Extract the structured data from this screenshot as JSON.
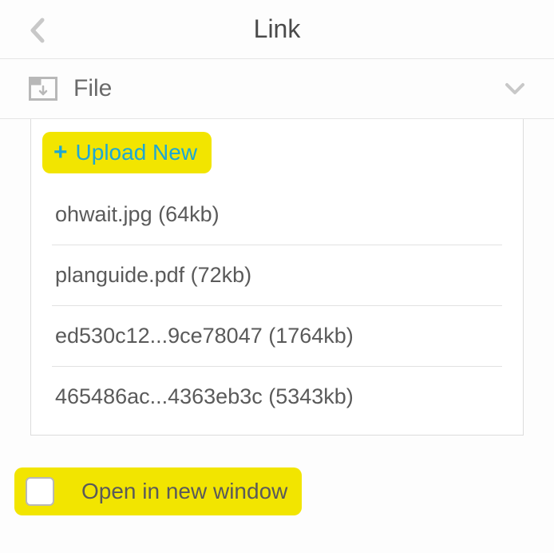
{
  "header": {
    "title": "Link"
  },
  "type_selector": {
    "label": "File"
  },
  "upload": {
    "label": "Upload New"
  },
  "files": [
    {
      "label": "ohwait.jpg (64kb)"
    },
    {
      "label": "planguide.pdf (72kb)"
    },
    {
      "label": "ed530c12...9ce78047 (1764kb)"
    },
    {
      "label": "465486ac...4363eb3c (5343kb)"
    }
  ],
  "checkbox": {
    "label": "Open in new window"
  }
}
